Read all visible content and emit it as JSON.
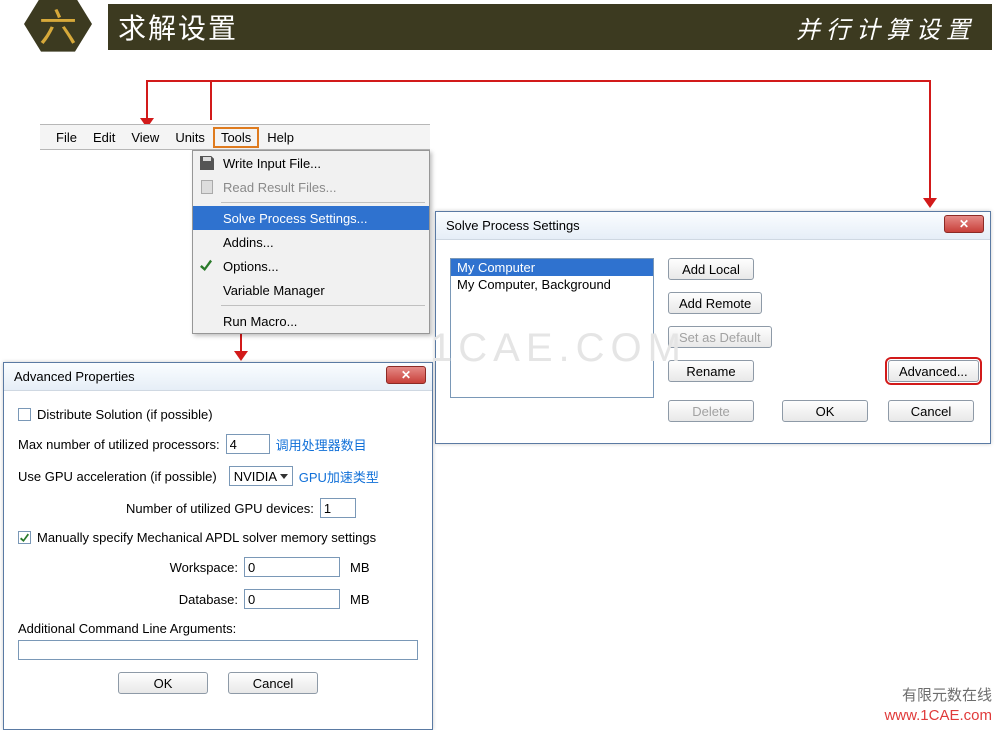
{
  "header": {
    "badge": "六",
    "title": "求解设置",
    "subtitle": "并行计算设置"
  },
  "menubar": {
    "items": [
      "File",
      "Edit",
      "View",
      "Units",
      "Tools",
      "Help"
    ]
  },
  "tools_menu": {
    "write_input": "Write Input File...",
    "read_results": "Read Result Files...",
    "solve_process": "Solve Process Settings...",
    "addins": "Addins...",
    "options": "Options...",
    "var_manager": "Variable Manager",
    "run_macro": "Run Macro..."
  },
  "sps": {
    "title": "Solve Process Settings",
    "list": [
      "My Computer",
      "My Computer, Background"
    ],
    "btn_add_local": "Add Local",
    "btn_add_remote": "Add Remote",
    "btn_set_default": "Set as Default",
    "btn_rename": "Rename",
    "btn_advanced": "Advanced...",
    "btn_delete": "Delete",
    "btn_ok": "OK",
    "btn_cancel": "Cancel"
  },
  "adv": {
    "title": "Advanced Properties",
    "distribute_label": "Distribute Solution (if possible)",
    "distribute_checked": false,
    "max_proc_label": "Max number of utilized processors:",
    "max_proc_value": "4",
    "max_proc_note": "调用处理器数目",
    "gpu_label": "Use GPU acceleration (if possible)",
    "gpu_select": "NVIDIA",
    "gpu_note": "GPU加速类型",
    "gpu_num_label": "Number of utilized GPU devices:",
    "gpu_num_value": "1",
    "mem_label": "Manually specify Mechanical APDL solver memory settings",
    "mem_checked": true,
    "workspace_label": "Workspace:",
    "workspace_value": "0",
    "database_label": "Database:",
    "database_value": "0",
    "mb": "MB",
    "cli_label": "Additional Command Line Arguments:",
    "btn_ok": "OK",
    "btn_cancel": "Cancel"
  },
  "watermark": {
    "center": "1CAE.COM",
    "brand": "有限元数在线",
    "url": "www.1CAE.com"
  }
}
